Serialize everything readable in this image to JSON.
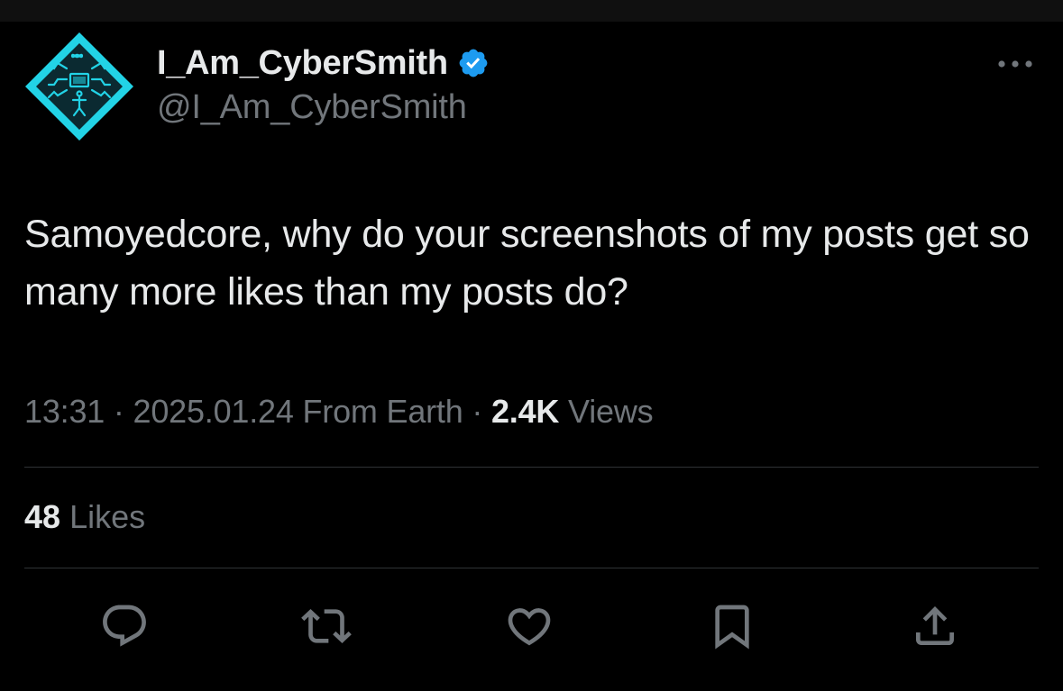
{
  "author": {
    "display_name": "I_Am_CyberSmith",
    "handle": "@I_Am_CyberSmith",
    "verified": true
  },
  "post": {
    "text": "Samoyedcore, why do your screenshots of my posts get so many more likes than my posts do?"
  },
  "meta": {
    "time": "13:31",
    "separator": "·",
    "date": "2025.01.24",
    "location": "From Earth",
    "views_count": "2.4K",
    "views_label": "Views"
  },
  "engagement": {
    "likes_count": "48",
    "likes_label": "Likes"
  },
  "icons": {
    "avatar": "cyber-diamond-avatar",
    "verified": "verified-badge-icon",
    "more": "more-options-icon",
    "reply": "reply-icon",
    "repost": "repost-icon",
    "like": "heart-icon",
    "bookmark": "bookmark-icon",
    "share": "share-icon"
  },
  "colors": {
    "background": "#000000",
    "primary_text": "#e7e9ea",
    "secondary_text": "#71767b",
    "divider": "#2f3336",
    "verified_blue": "#1d9bf0",
    "avatar_cyan": "#22d3e6"
  }
}
